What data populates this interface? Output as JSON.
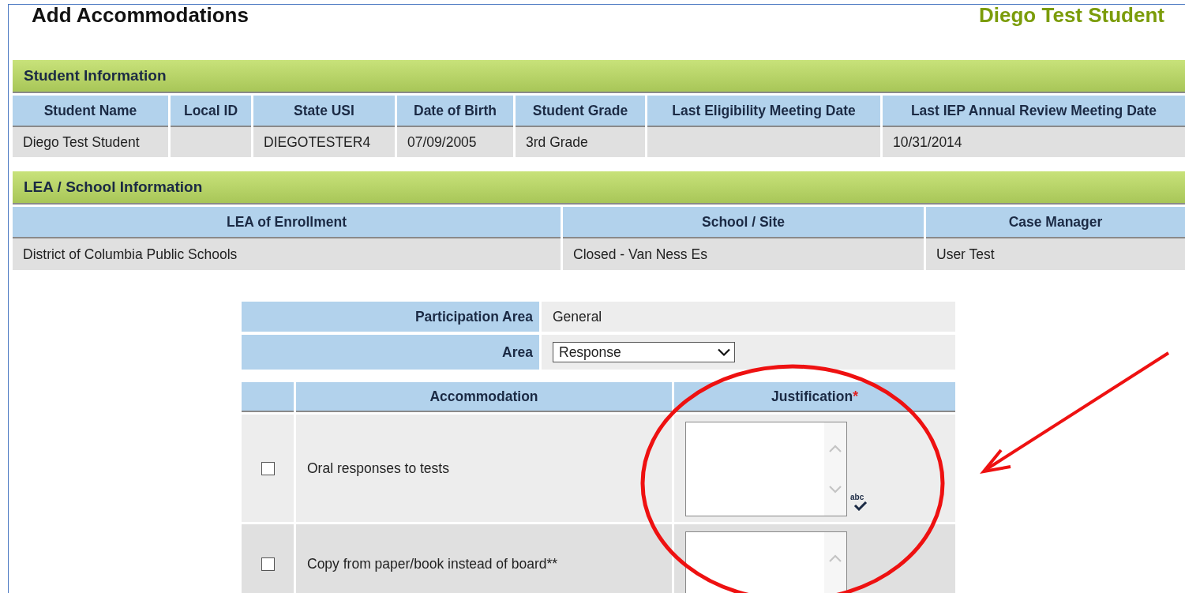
{
  "page": {
    "title": "Add Accommodations",
    "student": "Diego Test Student"
  },
  "student_information": {
    "title": "Student Information",
    "columns": [
      "Student Name",
      "Local ID",
      "State USI",
      "Date of Birth",
      "Student Grade",
      "Last Eligibility Meeting Date",
      "Last IEP Annual Review Meeting Date"
    ],
    "rows": [
      [
        "Diego Test Student",
        "",
        "DIEGOTESTER4",
        "07/09/2005",
        "3rd Grade",
        "",
        "10/31/2014"
      ]
    ]
  },
  "school_information": {
    "title": "LEA / School Information",
    "columns": [
      "LEA of Enrollment",
      "School / Site",
      "Case Manager"
    ],
    "rows": [
      [
        "District of Columbia Public Schools",
        "Closed - Van Ness Es",
        "User Test"
      ]
    ]
  },
  "form": {
    "fields": [
      {
        "kind": "text",
        "label": "Participation Area",
        "value": "General"
      },
      {
        "kind": "dropdown",
        "label": "Area",
        "value": "Response"
      }
    ]
  },
  "accommodations": {
    "columns": [
      {
        "label": "Accommodation"
      },
      {
        "label": "Justification",
        "required_mark": "*"
      }
    ],
    "rows": [
      {
        "checked": false,
        "label": "Oral responses to tests",
        "spellcheck": "abc"
      },
      {
        "checked": false,
        "label": "Copy from paper/book instead of board**"
      }
    ]
  },
  "annotations": {
    "circle": true,
    "arrow": true
  }
}
